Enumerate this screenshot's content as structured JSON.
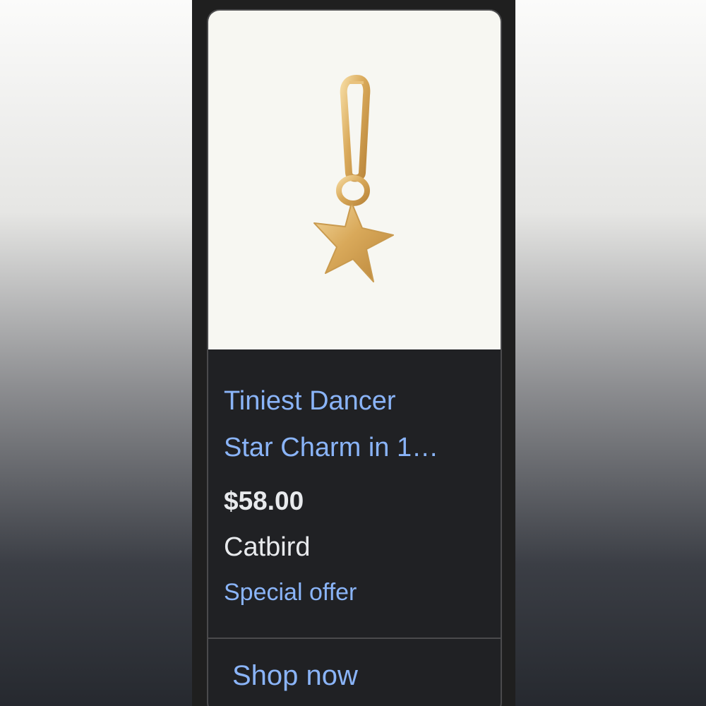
{
  "product": {
    "title_line1": "Tiniest Dancer",
    "title_line2": "Star Charm in 1…",
    "price": "$58.00",
    "merchant": "Catbird",
    "offer": "Special offer",
    "image_icon": "gold-star-charm-image"
  },
  "actions": {
    "shop_now": "Shop now"
  },
  "colors": {
    "link": "#8ab4f8",
    "text": "#e8eaed",
    "card_bg": "#202124",
    "image_bg": "#f7f7f2",
    "gold": "#d9a95a"
  }
}
